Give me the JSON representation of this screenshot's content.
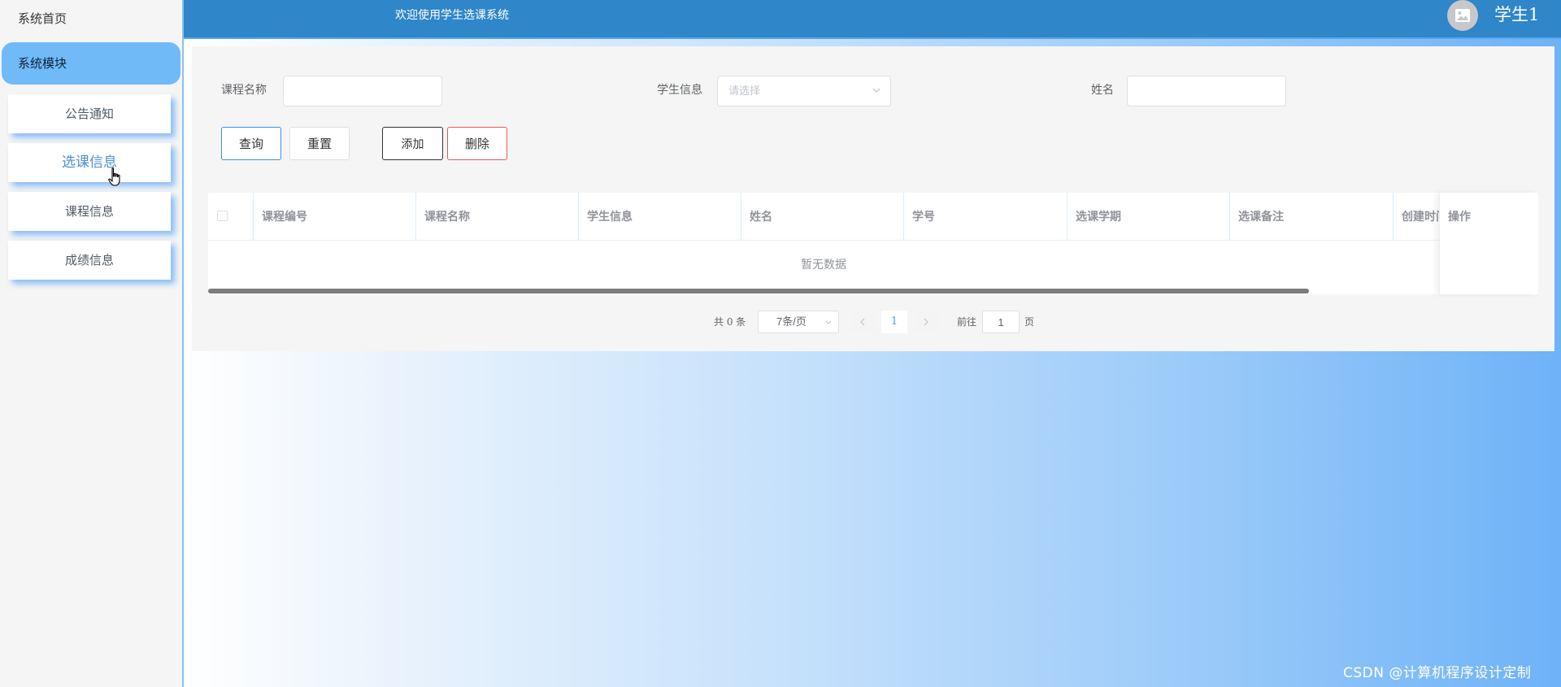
{
  "sidebar": {
    "home_label": "系统首页",
    "module_label": "系统模块",
    "items": [
      {
        "label": "公告通知"
      },
      {
        "label": "选课信息"
      },
      {
        "label": "课程信息"
      },
      {
        "label": "成绩信息"
      }
    ]
  },
  "header": {
    "title": "欢迎使用学生选课系统",
    "username": "学生1",
    "avatar_icon": "image-icon"
  },
  "search": {
    "course_name_label": "课程名称",
    "course_name_value": "",
    "student_info_label": "学生信息",
    "student_info_placeholder": "请选择",
    "name_label": "姓名",
    "name_value": ""
  },
  "buttons": {
    "query": "查询",
    "reset": "重置",
    "add": "添加",
    "delete": "删除"
  },
  "table": {
    "columns": [
      "课程编号",
      "课程名称",
      "学生信息",
      "姓名",
      "学号",
      "选课学期",
      "选课备注",
      "创建时间"
    ],
    "fixed_column": "操作",
    "empty_text": "暂无数据"
  },
  "pagination": {
    "total_text": "共 0 条",
    "page_size": "7条/页",
    "current_page": "1",
    "goto_label": "前往",
    "goto_value": "1",
    "page_unit": "页"
  },
  "watermark": "CSDN @计算机程序设计定制",
  "colors": {
    "header_bg": "#2f86c9",
    "sidebar_active": "#70baf8",
    "primary": "#409eff",
    "danger": "#e55a5a"
  }
}
